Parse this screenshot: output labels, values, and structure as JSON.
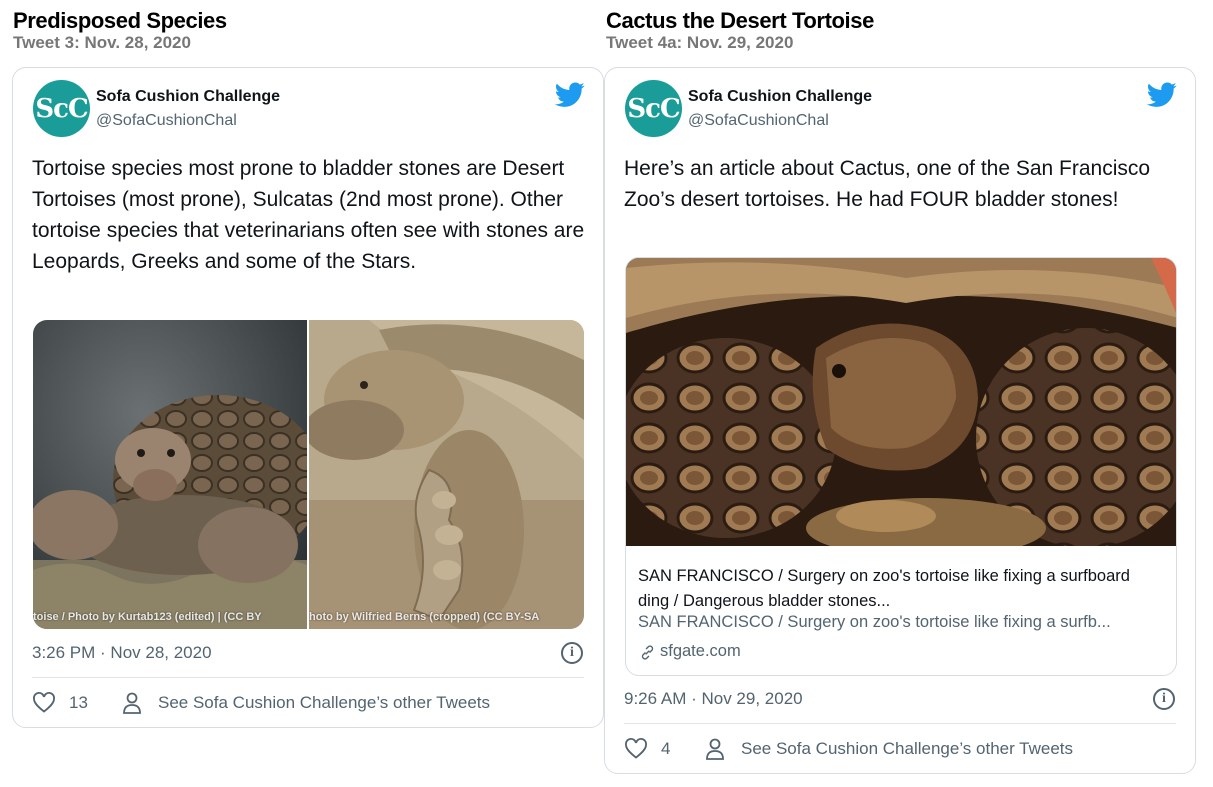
{
  "left": {
    "heading": "Predisposed Species",
    "subheading": "Tweet 3: Nov. 28, 2020",
    "tweet": {
      "avatar_text": "ScC",
      "author_name": "Sofa Cushion Challenge",
      "author_handle": "@SofaCushionChal",
      "text": "Tortoise species most prone to bladder stones are Desert Tortoises (most prone), Sulcatas (2nd most prone).  Other tortoise species that veterinarians often see with stones are Leopards, Greeks and some of the Stars.",
      "image_captions": [
        "toise / Photo by Kurtab123 (edited) | (CC BY",
        "hoto by Wilfried Berns (cropped) (CC BY-SA"
      ],
      "timestamp": "3:26 PM · Nov 28, 2020",
      "like_count": "13",
      "others_label": "See Sofa Cushion Challenge’s other Tweets"
    }
  },
  "right": {
    "heading": "Cactus the Desert Tortoise",
    "subheading": "Tweet 4a: Nov. 29, 2020",
    "tweet": {
      "avatar_text": "ScC",
      "author_name": "Sofa Cushion Challenge",
      "author_handle": "@SofaCushionChal",
      "text": "Here’s an article about Cactus, one of the San Francisco Zoo’s desert tortoises.  He had FOUR bladder stones!",
      "link_card": {
        "title": "SAN FRANCISCO / Surgery on zoo's tortoise like fixing a surfboard ding / Dangerous bladder stones...",
        "description": "SAN FRANCISCO / Surgery on zoo's tortoise like fixing a surfb...",
        "domain": "sfgate.com"
      },
      "timestamp": "9:26 AM · Nov 29, 2020",
      "like_count": "4",
      "others_label": "See Sofa Cushion Challenge’s other Tweets"
    }
  },
  "colors": {
    "twitter_blue": "#1d9bf0",
    "avatar_teal": "#1a9c98",
    "secondary_text": "#536471",
    "border": "#d7dde2"
  },
  "icons": [
    "twitter-bird-icon",
    "info-icon",
    "heart-icon",
    "person-icon",
    "link-icon"
  ]
}
